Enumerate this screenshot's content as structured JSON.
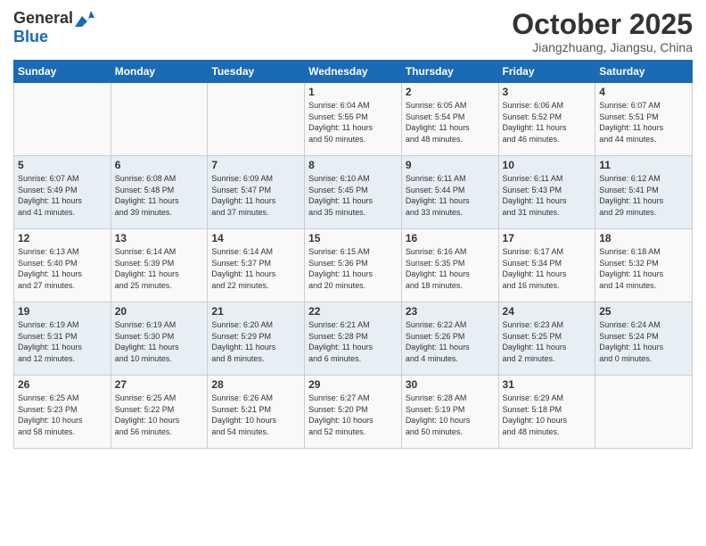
{
  "header": {
    "logo_general": "General",
    "logo_blue": "Blue",
    "month_title": "October 2025",
    "location": "Jiangzhuang, Jiangsu, China"
  },
  "weekdays": [
    "Sunday",
    "Monday",
    "Tuesday",
    "Wednesday",
    "Thursday",
    "Friday",
    "Saturday"
  ],
  "weeks": [
    [
      {
        "day": "",
        "info": ""
      },
      {
        "day": "",
        "info": ""
      },
      {
        "day": "",
        "info": ""
      },
      {
        "day": "1",
        "info": "Sunrise: 6:04 AM\nSunset: 5:55 PM\nDaylight: 11 hours\nand 50 minutes."
      },
      {
        "day": "2",
        "info": "Sunrise: 6:05 AM\nSunset: 5:54 PM\nDaylight: 11 hours\nand 48 minutes."
      },
      {
        "day": "3",
        "info": "Sunrise: 6:06 AM\nSunset: 5:52 PM\nDaylight: 11 hours\nand 46 minutes."
      },
      {
        "day": "4",
        "info": "Sunrise: 6:07 AM\nSunset: 5:51 PM\nDaylight: 11 hours\nand 44 minutes."
      }
    ],
    [
      {
        "day": "5",
        "info": "Sunrise: 6:07 AM\nSunset: 5:49 PM\nDaylight: 11 hours\nand 41 minutes."
      },
      {
        "day": "6",
        "info": "Sunrise: 6:08 AM\nSunset: 5:48 PM\nDaylight: 11 hours\nand 39 minutes."
      },
      {
        "day": "7",
        "info": "Sunrise: 6:09 AM\nSunset: 5:47 PM\nDaylight: 11 hours\nand 37 minutes."
      },
      {
        "day": "8",
        "info": "Sunrise: 6:10 AM\nSunset: 5:45 PM\nDaylight: 11 hours\nand 35 minutes."
      },
      {
        "day": "9",
        "info": "Sunrise: 6:11 AM\nSunset: 5:44 PM\nDaylight: 11 hours\nand 33 minutes."
      },
      {
        "day": "10",
        "info": "Sunrise: 6:11 AM\nSunset: 5:43 PM\nDaylight: 11 hours\nand 31 minutes."
      },
      {
        "day": "11",
        "info": "Sunrise: 6:12 AM\nSunset: 5:41 PM\nDaylight: 11 hours\nand 29 minutes."
      }
    ],
    [
      {
        "day": "12",
        "info": "Sunrise: 6:13 AM\nSunset: 5:40 PM\nDaylight: 11 hours\nand 27 minutes."
      },
      {
        "day": "13",
        "info": "Sunrise: 6:14 AM\nSunset: 5:39 PM\nDaylight: 11 hours\nand 25 minutes."
      },
      {
        "day": "14",
        "info": "Sunrise: 6:14 AM\nSunset: 5:37 PM\nDaylight: 11 hours\nand 22 minutes."
      },
      {
        "day": "15",
        "info": "Sunrise: 6:15 AM\nSunset: 5:36 PM\nDaylight: 11 hours\nand 20 minutes."
      },
      {
        "day": "16",
        "info": "Sunrise: 6:16 AM\nSunset: 5:35 PM\nDaylight: 11 hours\nand 18 minutes."
      },
      {
        "day": "17",
        "info": "Sunrise: 6:17 AM\nSunset: 5:34 PM\nDaylight: 11 hours\nand 16 minutes."
      },
      {
        "day": "18",
        "info": "Sunrise: 6:18 AM\nSunset: 5:32 PM\nDaylight: 11 hours\nand 14 minutes."
      }
    ],
    [
      {
        "day": "19",
        "info": "Sunrise: 6:19 AM\nSunset: 5:31 PM\nDaylight: 11 hours\nand 12 minutes."
      },
      {
        "day": "20",
        "info": "Sunrise: 6:19 AM\nSunset: 5:30 PM\nDaylight: 11 hours\nand 10 minutes."
      },
      {
        "day": "21",
        "info": "Sunrise: 6:20 AM\nSunset: 5:29 PM\nDaylight: 11 hours\nand 8 minutes."
      },
      {
        "day": "22",
        "info": "Sunrise: 6:21 AM\nSunset: 5:28 PM\nDaylight: 11 hours\nand 6 minutes."
      },
      {
        "day": "23",
        "info": "Sunrise: 6:22 AM\nSunset: 5:26 PM\nDaylight: 11 hours\nand 4 minutes."
      },
      {
        "day": "24",
        "info": "Sunrise: 6:23 AM\nSunset: 5:25 PM\nDaylight: 11 hours\nand 2 minutes."
      },
      {
        "day": "25",
        "info": "Sunrise: 6:24 AM\nSunset: 5:24 PM\nDaylight: 11 hours\nand 0 minutes."
      }
    ],
    [
      {
        "day": "26",
        "info": "Sunrise: 6:25 AM\nSunset: 5:23 PM\nDaylight: 10 hours\nand 58 minutes."
      },
      {
        "day": "27",
        "info": "Sunrise: 6:25 AM\nSunset: 5:22 PM\nDaylight: 10 hours\nand 56 minutes."
      },
      {
        "day": "28",
        "info": "Sunrise: 6:26 AM\nSunset: 5:21 PM\nDaylight: 10 hours\nand 54 minutes."
      },
      {
        "day": "29",
        "info": "Sunrise: 6:27 AM\nSunset: 5:20 PM\nDaylight: 10 hours\nand 52 minutes."
      },
      {
        "day": "30",
        "info": "Sunrise: 6:28 AM\nSunset: 5:19 PM\nDaylight: 10 hours\nand 50 minutes."
      },
      {
        "day": "31",
        "info": "Sunrise: 6:29 AM\nSunset: 5:18 PM\nDaylight: 10 hours\nand 48 minutes."
      },
      {
        "day": "",
        "info": ""
      }
    ]
  ]
}
